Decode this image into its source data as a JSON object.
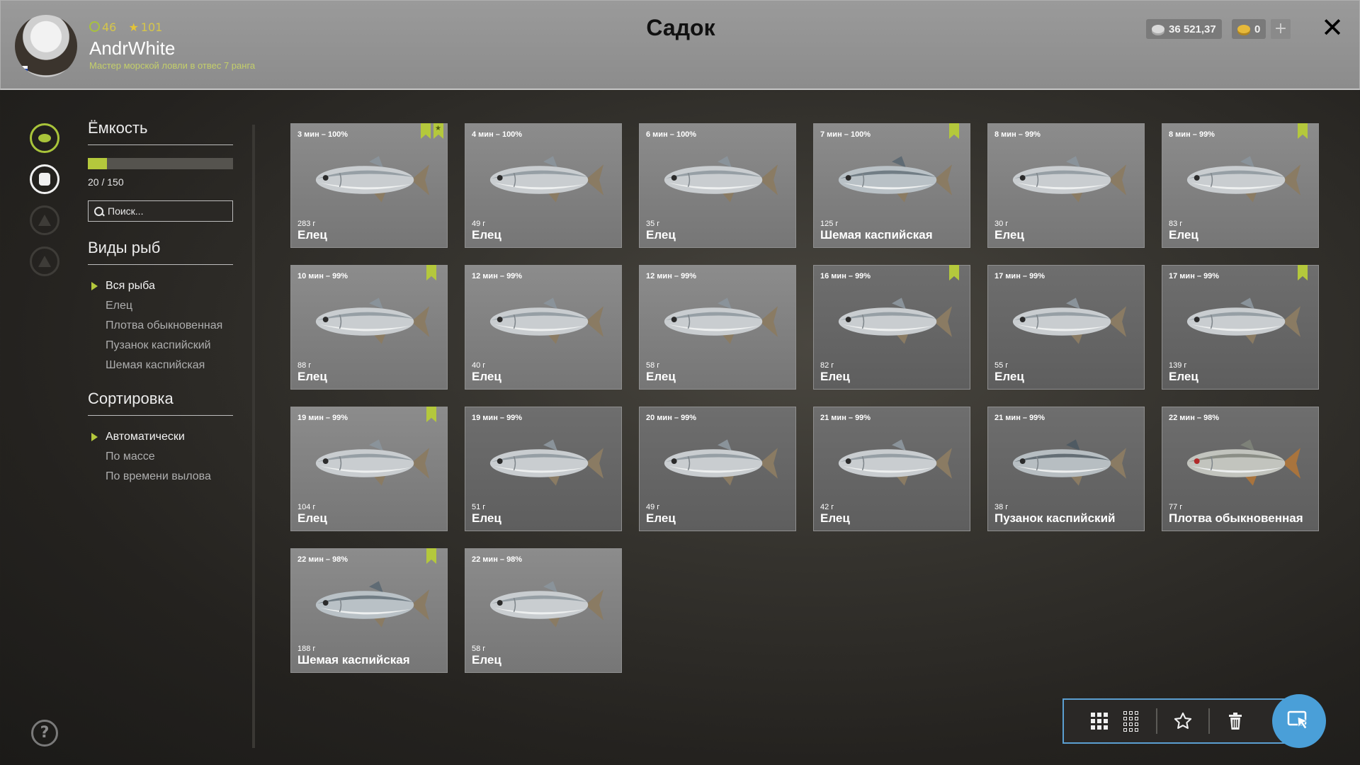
{
  "header": {
    "title": "Садок",
    "user": {
      "name": "AndrWhite",
      "level": "46",
      "stars": "101",
      "rank": "Мастер морской ловли в отвес 7 ранга"
    },
    "silver": "36 521,37",
    "gold": "0",
    "plus_label": "+",
    "close_label": "✕"
  },
  "sidebar": {
    "capacity": {
      "title": "Ёмкость",
      "value": "20 / 150",
      "fill_fraction": 0.1333
    },
    "search": {
      "placeholder": "Поиск..."
    },
    "species": {
      "title": "Виды рыб",
      "items": [
        "Вся рыба",
        "Елец",
        "Плотва обыкновенная",
        "Пузанок каспийский",
        "Шемая каспийская"
      ],
      "active_index": 0
    },
    "sort": {
      "title": "Сортировка",
      "items": [
        "Автоматически",
        "По массе",
        "По времени вылова"
      ],
      "active_index": 0
    },
    "help_label": "?"
  },
  "fish": [
    {
      "time": "3 мин – 100%",
      "weight": "283 г",
      "name": "Елец",
      "bookmark": true,
      "star": true
    },
    {
      "time": "4 мин – 100%",
      "weight": "49 г",
      "name": "Елец",
      "bookmark": false,
      "star": false
    },
    {
      "time": "6 мин – 100%",
      "weight": "35 г",
      "name": "Елец",
      "bookmark": false,
      "star": false
    },
    {
      "time": "7 мин – 100%",
      "weight": "125 г",
      "name": "Шемая каспийская",
      "bookmark": true,
      "star": false
    },
    {
      "time": "8 мин – 99%",
      "weight": "30 г",
      "name": "Елец",
      "bookmark": false,
      "star": false
    },
    {
      "time": "8 мин – 99%",
      "weight": "83 г",
      "name": "Елец",
      "bookmark": true,
      "star": false
    },
    {
      "time": "10 мин – 99%",
      "weight": "88 г",
      "name": "Елец",
      "bookmark": true,
      "star": false
    },
    {
      "time": "12 мин – 99%",
      "weight": "40 г",
      "name": "Елец",
      "bookmark": false,
      "star": false
    },
    {
      "time": "12 мин – 99%",
      "weight": "58 г",
      "name": "Елец",
      "bookmark": false,
      "star": false
    },
    {
      "time": "16 мин – 99%",
      "weight": "82 г",
      "name": "Елец",
      "bookmark": true,
      "star": false
    },
    {
      "time": "17 мин – 99%",
      "weight": "55 г",
      "name": "Елец",
      "bookmark": false,
      "star": false
    },
    {
      "time": "17 мин – 99%",
      "weight": "139 г",
      "name": "Елец",
      "bookmark": true,
      "star": false
    },
    {
      "time": "19 мин – 99%",
      "weight": "104 г",
      "name": "Елец",
      "bookmark": true,
      "star": false
    },
    {
      "time": "19 мин – 99%",
      "weight": "51 г",
      "name": "Елец",
      "bookmark": false,
      "star": false
    },
    {
      "time": "20 мин – 99%",
      "weight": "49 г",
      "name": "Елец",
      "bookmark": false,
      "star": false
    },
    {
      "time": "21 мин – 99%",
      "weight": "42 г",
      "name": "Елец",
      "bookmark": false,
      "star": false
    },
    {
      "time": "21 мин – 99%",
      "weight": "38 г",
      "name": "Пузанок каспийский",
      "bookmark": false,
      "star": false
    },
    {
      "time": "22 мин – 98%",
      "weight": "77 г",
      "name": "Плотва обыкновенная",
      "bookmark": false,
      "star": false
    },
    {
      "time": "22 мин – 98%",
      "weight": "188 г",
      "name": "Шемая каспийская",
      "bookmark": true,
      "star": false
    },
    {
      "time": "22 мин – 98%",
      "weight": "58 г",
      "name": "Елец",
      "bookmark": false,
      "star": false
    }
  ],
  "toolbar": {
    "icons": [
      "grid-large-icon",
      "grid-small-icon",
      "star-icon",
      "trash-icon",
      "cursor-select-icon"
    ]
  },
  "colors": {
    "accent": "#b4c83c",
    "select_blue": "#4a9fd8"
  }
}
